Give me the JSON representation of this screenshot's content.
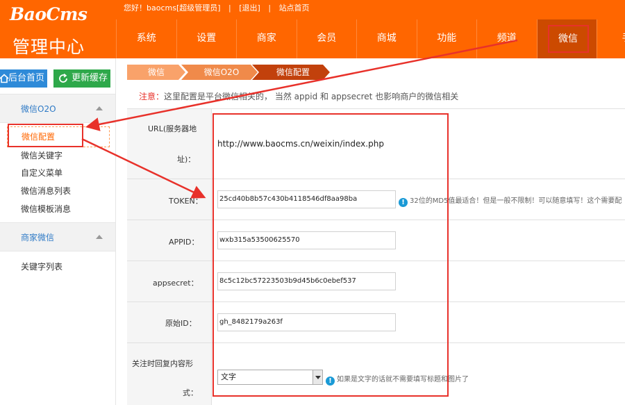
{
  "brand": {
    "name": "BaoCms",
    "subtitle": "管理中心"
  },
  "topbar": {
    "greeting": "您好！baocms[超级管理员]",
    "logout": "[退出]",
    "site_home": "站点首页"
  },
  "nav": {
    "items": [
      {
        "label": "系统"
      },
      {
        "label": "设置"
      },
      {
        "label": "商家"
      },
      {
        "label": "会员"
      },
      {
        "label": "商城"
      },
      {
        "label": "功能"
      },
      {
        "label": "频道"
      },
      {
        "label": "微信"
      },
      {
        "label": "手"
      }
    ],
    "active_index": 7
  },
  "sidebar": {
    "home_button": "后台首页",
    "refresh_button": "更新缓存",
    "groups": [
      {
        "title": "微信O2O",
        "items": [
          "微信配置",
          "微信关键字",
          "自定义菜单",
          "微信消息列表",
          "微信模板消息"
        ]
      },
      {
        "title": "商家微信",
        "items": [
          "关键字列表"
        ]
      }
    ]
  },
  "breadcrumb": [
    "微信",
    "微信O2O",
    "微信配置"
  ],
  "notice": {
    "prefix": "注意：",
    "text": "这里配置是平台微信相关的， 当然 appid 和 appsecret 也影响商户的微信相关"
  },
  "form": {
    "url_label_line1": "URL(服务器地",
    "url_label_line2": "址)：",
    "url_value": "http://www.baocms.cn/weixin/index.php",
    "token_label": "TOKEN：",
    "token_value": "25cd40b8b57c430b4118546df8aa98ba",
    "token_hint": "32位的MD5值最适合！但是一般不限制！可以随意填写！这个需要配",
    "appid_label": "APPID：",
    "appid_value": "wxb315a53500625570",
    "appsecret_label": "appsecret：",
    "appsecret_value": "8c5c12bc57223503b9d45b6c0ebef537",
    "origin_label": "原始ID：",
    "origin_value": "gh_8482179a263f",
    "reply_label_line1": "关注时回复内容形",
    "reply_label_line2": "式：",
    "reply_value": "文字",
    "reply_hint": "如果是文字的话就不需要填写标题和图片了"
  },
  "colors": {
    "brand_orange": "#ff6600",
    "highlight_red": "#e8312a",
    "link_blue": "#2e7ac6"
  }
}
